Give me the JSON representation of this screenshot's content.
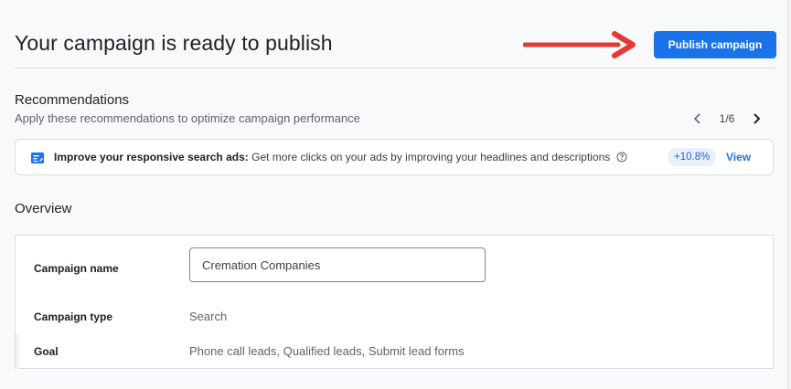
{
  "header": {
    "title": "Your campaign is ready to publish",
    "publish_button": "Publish campaign"
  },
  "recommendations": {
    "title": "Recommendations",
    "subtitle": "Apply these recommendations to optimize campaign performance",
    "pager": "1/6",
    "card": {
      "title": "Improve your responsive search ads:",
      "description": "Get more clicks on your ads by improving your headlines and descriptions",
      "uplift": "+10.8%",
      "action": "View"
    }
  },
  "overview": {
    "title": "Overview",
    "rows": [
      {
        "label": "Campaign name",
        "value": "Cremation Companies"
      },
      {
        "label": "Campaign type",
        "value": "Search"
      },
      {
        "label": "Goal",
        "value": "Phone call leads, Qualified leads, Submit lead forms"
      }
    ]
  },
  "colors": {
    "primary": "#1a73e8",
    "annotation_arrow": "#e53935",
    "uplift_bg": "#e8f0fe"
  },
  "icons": [
    "arrow-right-icon",
    "chevron-left-icon",
    "chevron-right-icon",
    "ad-edit-icon",
    "help-icon"
  ]
}
